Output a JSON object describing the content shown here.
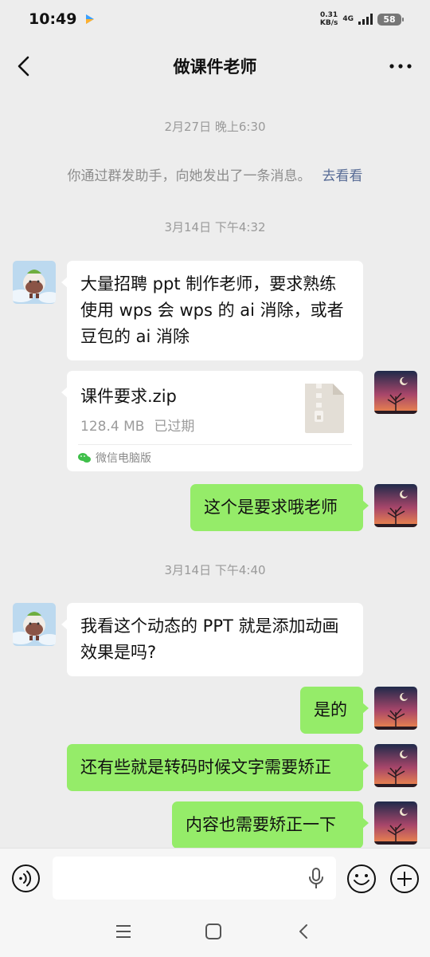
{
  "status_bar": {
    "time": "10:49",
    "net_speed_value": "0.31",
    "net_speed_unit": "KB/s",
    "network": "4G",
    "battery": "58"
  },
  "header": {
    "title": "做课件老师"
  },
  "messages": {
    "ts1": "2月27日 晚上6:30",
    "system_text": "你通过群发助手，向她发出了一条消息。",
    "system_link": "去看看",
    "ts2": "3月14日 下午4:32",
    "in1_lines": [
      "大量招聘 ppt 制作老师，要求熟练",
      "使用 wps 会 wps 的 ai 消除，或者",
      "豆包的 ai 消除"
    ],
    "file": {
      "name": "课件要求.zip",
      "size": "128.4 MB",
      "status": "已过期",
      "source": "微信电脑版"
    },
    "out1": "这个是要求哦老师",
    "ts3": "3月14日 下午4:40",
    "in2_lines": [
      "我看这个动态的 PPT 就是添加动画",
      "效果是吗?"
    ],
    "out2": "是的",
    "out3": "还有些就是转码时候文字需要矫正",
    "out4": "内容也需要矫正一下"
  },
  "colors": {
    "background": "#ededed",
    "outgoing_bubble": "#95ec69",
    "incoming_bubble": "#ffffff",
    "link": "#576b95"
  },
  "icons": {
    "back": "chevron-left-icon",
    "more": "more-dots-icon",
    "voice": "voice-icon",
    "mic": "microphone-icon",
    "emoji": "emoji-icon",
    "plus": "plus-icon",
    "file": "zip-file-icon"
  }
}
